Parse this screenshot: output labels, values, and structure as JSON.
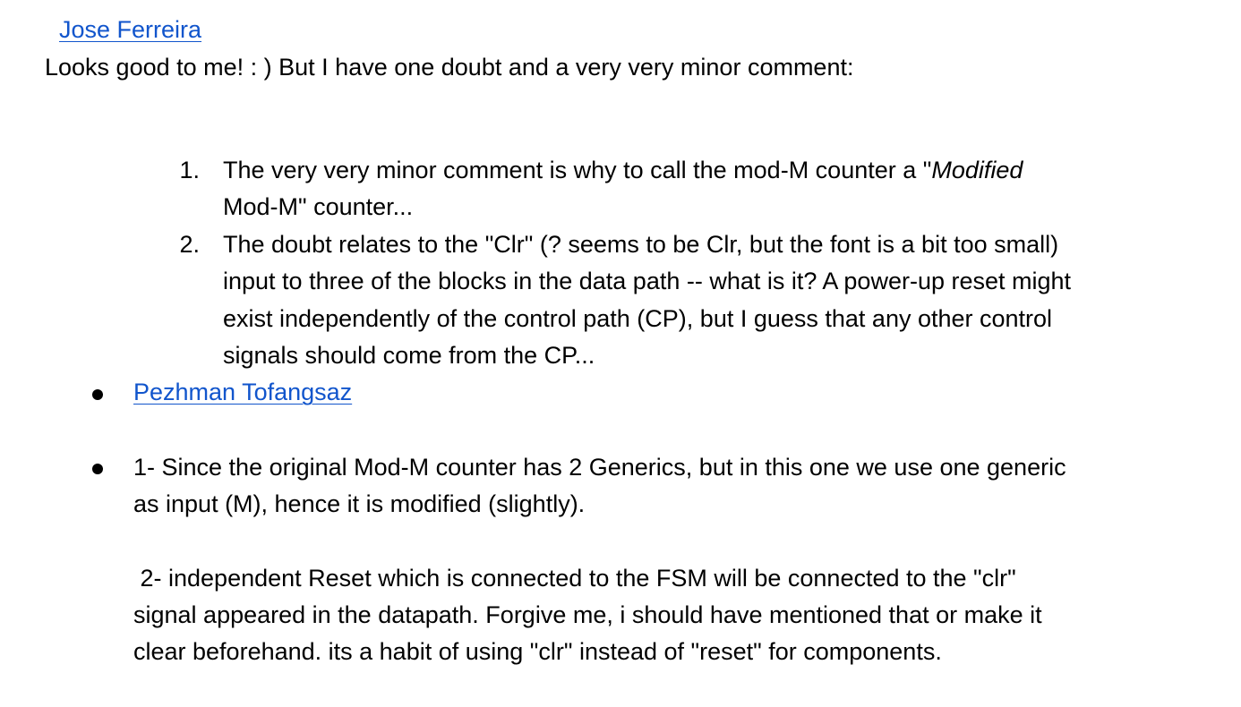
{
  "author_1": "Jose Ferreira",
  "comment_1": {
    "intro": "Looks good to me! : ) But I have one doubt and a very very minor comment:",
    "items": [
      {
        "number": "1.",
        "line1_pre": "The very very minor comment is why to call the mod-M counter a \"",
        "line1_em": "Modified",
        "line2": "Mod-M\" counter..."
      },
      {
        "number": "2.",
        "lines": [
          "The doubt relates to the \"Clr\" (? seems to be Clr, but the font is a bit too small)",
          "input to three of the blocks in the data path -- what is it? A power-up reset might",
          "exist independently of the control path (CP), but I guess that any other control",
          "signals should come from the CP..."
        ]
      }
    ]
  },
  "author_2": "Pezhman Tofangsaz",
  "reply": {
    "para1": [
      "1- Since the original Mod-M counter has 2 Generics, but in this one we use one generic",
      "as input (M), hence it is modified (slightly)."
    ],
    "para2": [
      " 2- independent Reset which is connected to the FSM will be connected to the \"clr\"",
      "signal appeared in the datapath. Forgive me, i should have mentioned that or make it",
      "clear beforehand. its a habit of using \"clr\" instead of \"reset\" for components."
    ]
  },
  "colors": {
    "link": "#1155cc",
    "text": "#000000",
    "background": "#ffffff"
  }
}
